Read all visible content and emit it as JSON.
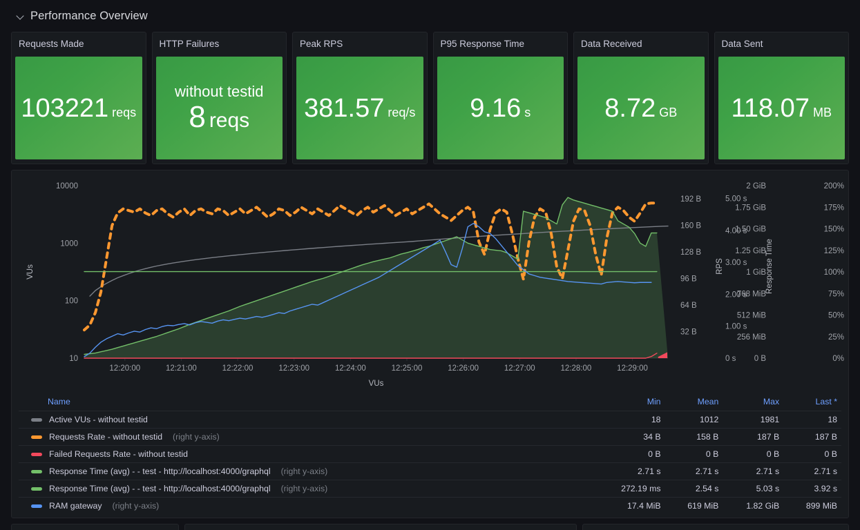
{
  "row": {
    "title": "Performance Overview",
    "collapse_icon": "chevron-down-icon"
  },
  "stats": [
    {
      "title": "Requests Made",
      "prefix": "",
      "value": "103221",
      "unit": "reqs",
      "variant": "normal",
      "color": "#56a64b"
    },
    {
      "title": "HTTP Failures",
      "prefix": "without testid",
      "value": "8",
      "unit": "reqs",
      "variant": "big",
      "color": "#56a64b"
    },
    {
      "title": "Peak RPS",
      "prefix": "",
      "value": "381.57",
      "unit": "req/s",
      "variant": "normal",
      "color": "#56a64b"
    },
    {
      "title": "P95 Response Time",
      "prefix": "",
      "value": "9.16",
      "unit": "s",
      "variant": "normal",
      "color": "#56a64b"
    },
    {
      "title": "Data Received",
      "prefix": "",
      "value": "8.72",
      "unit": "GB",
      "variant": "normal",
      "color": "#56a64b"
    },
    {
      "title": "Data Sent",
      "prefix": "",
      "value": "118.07",
      "unit": "MB",
      "variant": "normal",
      "color": "#56a64b"
    }
  ],
  "chart_data": {
    "type": "line",
    "title": "",
    "xlabel": "VUs",
    "x_tick_labels": [
      "12:20:00",
      "12:21:00",
      "12:22:00",
      "12:23:00",
      "12:24:00",
      "12:25:00",
      "12:26:00",
      "12:27:00",
      "12:28:00",
      "12:29:00"
    ],
    "grid": false,
    "legend_position": "bottom-table",
    "axes": [
      {
        "name": "VUs",
        "side": "left",
        "scale": "log",
        "ticks": [
          "10",
          "100",
          "1000",
          "10000"
        ],
        "range": [
          10,
          10000
        ]
      },
      {
        "name": "",
        "side": "right",
        "scale": "linear",
        "ticks": [
          "32 B",
          "64 B",
          "96 B",
          "128 B",
          "160 B",
          "192 B"
        ],
        "range": [
          0,
          208
        ]
      },
      {
        "name": "RPS",
        "side": "right",
        "scale": "linear",
        "ticks": [
          "0 s",
          "1.00 s",
          "2.00 s",
          "3.00 s",
          "4.00 s",
          "5.00 s"
        ],
        "range": [
          0,
          5.4
        ]
      },
      {
        "name": "Response Time",
        "side": "right",
        "scale": "linear",
        "ticks": [
          "0 B",
          "256 MiB",
          "512 MiB",
          "768 MiB",
          "1 GiB",
          "1.25 GiB",
          "1.50 GiB",
          "1.75 GiB",
          "2 GiB"
        ],
        "range": [
          0,
          2147483648
        ]
      },
      {
        "name": "",
        "side": "right",
        "scale": "linear",
        "ticks": [
          "0%",
          "25%",
          "50%",
          "75%",
          "100%",
          "125%",
          "150%",
          "175%",
          "200%"
        ],
        "range": [
          0,
          200
        ]
      }
    ],
    "series": [
      {
        "name": "Active VUs - without testid",
        "color": "#7b7f87",
        "style": "solid",
        "axis": "left",
        "values": [
          null,
          120,
          150,
          175,
          200,
          225,
          250,
          272,
          295,
          318,
          340,
          360,
          380,
          400,
          418,
          436,
          452,
          468,
          484,
          500,
          515,
          530,
          545,
          560,
          574,
          588,
          602,
          616,
          630,
          644,
          658,
          672,
          686,
          700,
          714,
          728,
          742,
          756,
          770,
          784,
          798,
          812,
          826,
          840,
          854,
          868,
          882,
          896,
          910,
          924,
          938,
          952,
          966,
          980,
          995,
          1010,
          1025,
          1040,
          1055,
          1070,
          1090,
          1110,
          1130,
          1150,
          1170,
          1190,
          1210,
          1230,
          1250,
          1270,
          1290,
          1310,
          1330,
          1350,
          1370,
          1390,
          1410,
          1430,
          1450,
          1470,
          1490,
          1510,
          1530,
          1550,
          1570,
          1590,
          1610,
          1630,
          1650,
          1670,
          1690,
          1710,
          1730,
          1750,
          1770,
          1790,
          1810,
          1830,
          1850,
          1870,
          1890,
          1910,
          1930,
          1950,
          1970,
          1981
        ]
      },
      {
        "name": "Requests Rate - without testid",
        "color": "#ff9830",
        "style": "dashed",
        "axis": "right-bytes",
        "values": [
          34,
          40,
          55,
          80,
          120,
          160,
          175,
          180,
          178,
          176,
          180,
          175,
          172,
          178,
          180,
          174,
          170,
          176,
          180,
          172,
          178,
          180,
          176,
          174,
          180,
          178,
          172,
          176,
          180,
          174,
          178,
          182,
          176,
          170,
          174,
          180,
          178,
          172,
          176,
          182,
          178,
          174,
          180,
          176,
          172,
          178,
          184,
          180,
          176,
          172,
          178,
          182,
          176,
          180,
          184,
          178,
          172,
          176,
          180,
          174,
          178,
          182,
          186,
          180,
          174,
          170,
          166,
          172,
          178,
          182,
          176,
          140,
          125,
          155,
          175,
          180,
          176,
          150,
          120,
          95,
          140,
          170,
          180,
          176,
          150,
          110,
          96,
          130,
          165,
          180,
          178,
          160,
          125,
          100,
          145,
          175,
          182,
          178,
          170,
          165,
          175,
          186,
          187,
          187
        ]
      },
      {
        "name": "Failed Requests Rate - without testid",
        "color": "#f2495c",
        "style": "solid",
        "axis": "right-bytes",
        "values": [
          0,
          0,
          0,
          0,
          0,
          0,
          0,
          0,
          0,
          0,
          0,
          0,
          0,
          0,
          0,
          0,
          0,
          0,
          0,
          0,
          0,
          0,
          0,
          0,
          0,
          0,
          0,
          0,
          0,
          0,
          0,
          0,
          0,
          0,
          0,
          0,
          0,
          0,
          0,
          0,
          0,
          0,
          0,
          0,
          0,
          0,
          0,
          0,
          0,
          0,
          0,
          0,
          0,
          0,
          0,
          0,
          0,
          0,
          0,
          0,
          0,
          0,
          0,
          0,
          0,
          0,
          0,
          0,
          0,
          0,
          0,
          0,
          0,
          0,
          0,
          0,
          0,
          0,
          0,
          0,
          0,
          0,
          0,
          0,
          0,
          0,
          0,
          0,
          0,
          0,
          0,
          0,
          0,
          0,
          0,
          0,
          0,
          0,
          0,
          0,
          0,
          0,
          2,
          6
        ]
      },
      {
        "name": "Response Time (avg) - - test - http://localhost:4000/graphql",
        "color": "#73bf69",
        "style": "solid-area",
        "axis": "right-seconds",
        "values": [
          0.12,
          0.14,
          0.16,
          0.2,
          0.24,
          0.28,
          0.33,
          0.38,
          0.43,
          0.48,
          0.53,
          0.58,
          0.63,
          0.68,
          0.74,
          0.8,
          0.86,
          0.92,
          0.99,
          1.06,
          1.12,
          1.18,
          1.24,
          1.3,
          1.36,
          1.42,
          1.48,
          1.55,
          1.62,
          1.68,
          1.74,
          1.8,
          1.86,
          1.92,
          1.98,
          2.04,
          2.1,
          2.16,
          2.22,
          2.28,
          2.34,
          2.4,
          2.45,
          2.5,
          2.56,
          2.62,
          2.68,
          2.74,
          2.8,
          2.86,
          2.92,
          2.97,
          3.02,
          3.06,
          3.1,
          3.14,
          3.2,
          3.26,
          3.3,
          3.35,
          3.4,
          3.46,
          3.5,
          3.56,
          3.62,
          3.68,
          3.74,
          3.8,
          3.7,
          3.6,
          3.55,
          3.5,
          3.45,
          3.4,
          3.38,
          3.36,
          3.3,
          3.2,
          3.1,
          4.6,
          4.55,
          4.5,
          4.45,
          4.4,
          4.3,
          4.2,
          4.8,
          5.03,
          4.95,
          4.9,
          4.85,
          4.8,
          4.75,
          4.7,
          4.65,
          4.6,
          4.3,
          4.2,
          4.1,
          3.9,
          3.6,
          3.5,
          3.92,
          3.92
        ]
      },
      {
        "name": "Response Time (avg) - - test - http://localhost:4000/graphql",
        "color": "#73bf69",
        "style": "solid",
        "axis": "right-seconds",
        "values": [
          2.71,
          2.71,
          2.71,
          2.71,
          2.71,
          2.71,
          2.71,
          2.71,
          2.71,
          2.71,
          2.71,
          2.71,
          2.71,
          2.71,
          2.71,
          2.71,
          2.71,
          2.71,
          2.71,
          2.71,
          2.71,
          2.71,
          2.71,
          2.71,
          2.71,
          2.71,
          2.71,
          2.71,
          2.71,
          2.71,
          2.71,
          2.71,
          2.71,
          2.71,
          2.71,
          2.71,
          2.71,
          2.71,
          2.71,
          2.71,
          2.71,
          2.71,
          2.71,
          2.71,
          2.71,
          2.71,
          2.71,
          2.71,
          2.71,
          2.71,
          2.71,
          2.71,
          2.71,
          2.71,
          2.71,
          2.71,
          2.71,
          2.71,
          2.71,
          2.71,
          2.71,
          2.71,
          2.71,
          2.71,
          2.71,
          2.71,
          2.71,
          2.71,
          2.71,
          2.71,
          2.71,
          2.71,
          2.71,
          2.71,
          2.71,
          2.71,
          2.71,
          2.71,
          2.71,
          2.71,
          2.71,
          2.71,
          2.71,
          2.71,
          2.71,
          2.71,
          2.71,
          2.71,
          2.71,
          2.71,
          2.71,
          2.71,
          2.71,
          2.71,
          2.71,
          2.71,
          2.71,
          2.71,
          2.71,
          2.71,
          2.71,
          2.71,
          2.71,
          2.71
        ]
      },
      {
        "name": "RAM gateway",
        "color": "#5794f2",
        "style": "solid",
        "axis": "right-mem",
        "values": [
          17.4,
          60,
          130,
          190,
          230,
          260,
          290,
          275,
          300,
          320,
          310,
          340,
          360,
          350,
          375,
          390,
          385,
          400,
          410,
          395,
          420,
          435,
          425,
          415,
          440,
          455,
          445,
          460,
          475,
          465,
          480,
          495,
          485,
          500,
          520,
          540,
          530,
          560,
          580,
          600,
          620,
          640,
          630,
          660,
          690,
          720,
          750,
          780,
          810,
          840,
          870,
          900,
          930,
          960,
          1000,
          1040,
          1080,
          1120,
          1160,
          1200,
          1240,
          1280,
          1320,
          1360,
          1400,
          1260,
          1110,
          1080,
          1300,
          1560,
          1600,
          1560,
          1500,
          1480,
          1420,
          1340,
          1260,
          1180,
          1100,
          1050,
          1000,
          980,
          960,
          950,
          940,
          930,
          920,
          910,
          905,
          900,
          895,
          890,
          885,
          880,
          899,
          905,
          910,
          905,
          900,
          895,
          899,
          899,
          899
        ]
      }
    ]
  },
  "legend": {
    "columns": [
      "Name",
      "Min",
      "Mean",
      "Max",
      "Last *"
    ],
    "rows": [
      {
        "color": "#7b7f87",
        "name": "Active VUs - without testid",
        "axis_note": "",
        "min": "18",
        "mean": "1012",
        "max": "1981",
        "last": "18"
      },
      {
        "color": "#ff9830",
        "name": "Requests Rate - without testid",
        "axis_note": "(right y-axis)",
        "min": "34 B",
        "mean": "158 B",
        "max": "187 B",
        "last": "187 B"
      },
      {
        "color": "#f2495c",
        "name": "Failed Requests Rate - without testid",
        "axis_note": "",
        "min": "0 B",
        "mean": "0 B",
        "max": "0 B",
        "last": "0 B"
      },
      {
        "color": "#73bf69",
        "name": "Response Time (avg) - - test - http://localhost:4000/graphql",
        "axis_note": "(right y-axis)",
        "min": "2.71 s",
        "mean": "2.71 s",
        "max": "2.71 s",
        "last": "2.71 s"
      },
      {
        "color": "#73bf69",
        "name": "Response Time (avg) - - test - http://localhost:4000/graphql",
        "axis_note": "(right y-axis)",
        "min": "272.19 ms",
        "mean": "2.54 s",
        "max": "5.03 s",
        "last": "3.92 s"
      },
      {
        "color": "#5794f2",
        "name": "RAM gateway",
        "axis_note": "(right y-axis)",
        "min": "17.4 MiB",
        "mean": "619 MiB",
        "max": "1.82 GiB",
        "last": "899 MiB"
      }
    ]
  }
}
